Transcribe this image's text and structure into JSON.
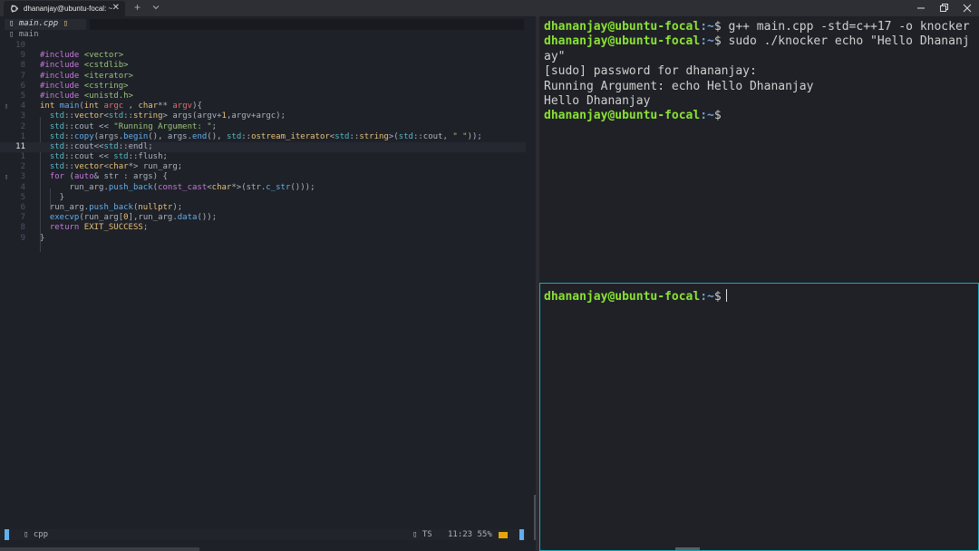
{
  "window": {
    "tab_title": "dhananjay@ubuntu-focal: ~",
    "tab_close": "✕",
    "new_tab": "+",
    "dropdown": "chevron-down",
    "controls": [
      "minimize",
      "restore",
      "close"
    ]
  },
  "editor": {
    "buffer_name": "main.cpp",
    "buffer_flag": "▯",
    "buffer_icon": "▯",
    "winbar_icon": "▯",
    "winbar_symbol": "main",
    "cursor_line": "11",
    "lines": [
      {
        "num": "10",
        "sign": "",
        "html": ""
      },
      {
        "num": "9",
        "sign": "",
        "html": "<span class=\"pp\">#include</span> <span class=\"hd\">&lt;vector&gt;</span>"
      },
      {
        "num": "8",
        "sign": "",
        "html": "<span class=\"pp\">#include</span> <span class=\"hd\">&lt;cstdlib&gt;</span>"
      },
      {
        "num": "7",
        "sign": "",
        "html": "<span class=\"pp\">#include</span> <span class=\"hd\">&lt;iterator&gt;</span>"
      },
      {
        "num": "6",
        "sign": "",
        "html": "<span class=\"pp\">#include</span> <span class=\"hd\">&lt;cstring&gt;</span>"
      },
      {
        "num": "5",
        "sign": "",
        "html": "<span class=\"pp\">#include</span> <span class=\"hd\">&lt;unistd.h&gt;</span>"
      },
      {
        "num": "4",
        "sign": "▯",
        "html": "<span class=\"ty\">int</span> <span class=\"fn\">main</span>(<span class=\"ty\">int</span> <span class=\"pa\">argc</span> , <span class=\"ty\">char</span>** <span class=\"pa\">argv</span>){"
      },
      {
        "num": "3",
        "sign": "",
        "html": "  <span class=\"ns\">std</span>::<span class=\"ty\">vector</span>&lt;<span class=\"ns\">std</span>::<span class=\"ty\">string</span>&gt; args(argv+<span class=\"mac\">1</span>,argv+argc);"
      },
      {
        "num": "2",
        "sign": "",
        "html": "  <span class=\"ns\">std</span>::cout &lt;&lt; <span class=\"st\">\"Running Argument: \"</span>;"
      },
      {
        "num": "1",
        "sign": "",
        "html": "  <span class=\"ns\">std</span>::<span class=\"fn\">copy</span>(args.<span class=\"fn\">begin</span>(), args.<span class=\"fn\">end</span>(), <span class=\"ns\">std</span>::<span class=\"ty\">ostream_iterator</span>&lt;<span class=\"ns\">std</span>::<span class=\"ty\">string</span>&gt;(<span class=\"ns\">std</span>::cout, <span class=\"st\">\" \"</span>));"
      },
      {
        "num": "11",
        "sign": "",
        "cur": true,
        "html": "  <span class=\"ns\">std</span>::cout&lt;&lt;<span class=\"ns\">std</span>::endl;"
      },
      {
        "num": "1",
        "sign": "",
        "html": "  <span class=\"ns\">std</span>::cout &lt;&lt; <span class=\"ns\">std</span>::flush;"
      },
      {
        "num": "2",
        "sign": "",
        "html": "  <span class=\"ns\">std</span>::<span class=\"ty\">vector</span>&lt;<span class=\"ty\">char</span>*&gt; run_arg;"
      },
      {
        "num": "3",
        "sign": "▯",
        "html": "  <span class=\"kw\">for</span> (<span class=\"kw\">auto</span>&amp; str : args) {"
      },
      {
        "num": "4",
        "sign": "",
        "html": "      run_arg.<span class=\"fn\">push_back</span>(<span class=\"kw\">const_cast</span>&lt;<span class=\"ty\">char</span>*&gt;(str.<span class=\"fn\">c_str</span>()));"
      },
      {
        "num": "5",
        "sign": "",
        "html": "    }"
      },
      {
        "num": "6",
        "sign": "",
        "html": "  run_arg.<span class=\"fn\">push_back</span>(<span class=\"mac\">nullptr</span>);"
      },
      {
        "num": "7",
        "sign": "",
        "html": "  <span class=\"fn\">execvp</span>(run_arg[<span class=\"mac\">0</span>],run_arg.<span class=\"fn\">data</span>());"
      },
      {
        "num": "8",
        "sign": "",
        "html": "  <span class=\"kw\">return</span> <span class=\"mac\">EXIT_SUCCESS</span>;"
      },
      {
        "num": "9",
        "sign": "",
        "html": "}"
      }
    ],
    "status": {
      "filetype_icon": "▯",
      "filetype": "cpp",
      "lsp_icon": "▯",
      "lsp": "TS",
      "position": "11:23",
      "percent": "55%"
    }
  },
  "terminal_top": {
    "user_host": "dhananjay@ubuntu-focal",
    "path": ":~",
    "dollar": "$",
    "cmd1": " g++ main.cpp -std=c++17 -o knocker",
    "cmd2": " sudo ./knocker echo \"Hello Dhananjay\"",
    "out1": "[sudo] password for dhananjay:",
    "out2": "Running Argument: echo Hello Dhananjay",
    "out3": "Hello Dhananjay"
  },
  "terminal_bottom": {
    "user_host": "dhananjay@ubuntu-focal",
    "path": ":~",
    "dollar": "$"
  }
}
